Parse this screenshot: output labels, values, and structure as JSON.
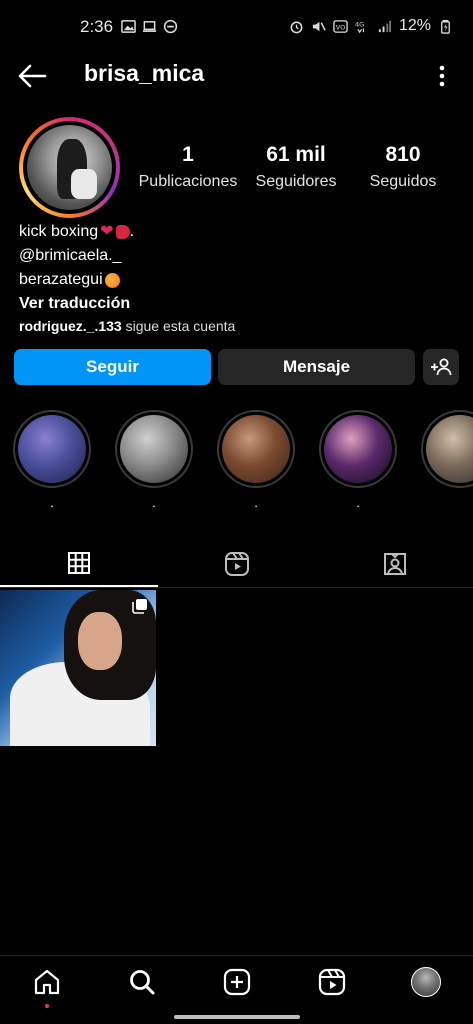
{
  "status_bar": {
    "time": "2:36",
    "battery": "12%"
  },
  "header": {
    "username": "brisa_mica"
  },
  "profile": {
    "stats": [
      {
        "value": "1",
        "label": "Publicaciones"
      },
      {
        "value": "61 mil",
        "label": "Seguidores"
      },
      {
        "value": "810",
        "label": "Seguidos"
      }
    ],
    "bio": {
      "line1": "kick boxing",
      "line1_suffix": ".",
      "line2": "@brimicaela._",
      "line3": "berazategui",
      "translate": "Ver traducción",
      "followed_by_user": "rodriguez._.133",
      "followed_by_text": " sigue esta cuenta"
    }
  },
  "actions": {
    "follow_label": "Seguir",
    "message_label": "Mensaje"
  },
  "highlights": [
    {
      "label": ".",
      "colors": [
        "#1b1f4a",
        "#4a4f9a",
        "#8a7fd0"
      ]
    },
    {
      "label": ".",
      "colors": [
        "#2b2b2b",
        "#8a8a8a",
        "#d0d0d0"
      ]
    },
    {
      "label": ".",
      "colors": [
        "#3a2418",
        "#7a4a30",
        "#c79a7a"
      ]
    },
    {
      "label": ".",
      "colors": [
        "#120a1c",
        "#5a2a6a",
        "#e0a0c0"
      ]
    },
    {
      "label": "",
      "colors": [
        "#2a2a2a",
        "#7a6a5a",
        "#cfc0a8"
      ]
    }
  ],
  "colors": {
    "accent": "#0095f6",
    "button_dark": "#262626",
    "notification_dot": "#ff3040"
  },
  "icons": {
    "back": "arrow-left-icon",
    "more": "more-vertical-icon",
    "add_friend": "add-person-icon",
    "grid": "grid-icon",
    "reels": "reels-icon",
    "tagged": "tagged-icon",
    "home": "home-icon",
    "search": "search-icon",
    "create": "plus-square-icon"
  }
}
